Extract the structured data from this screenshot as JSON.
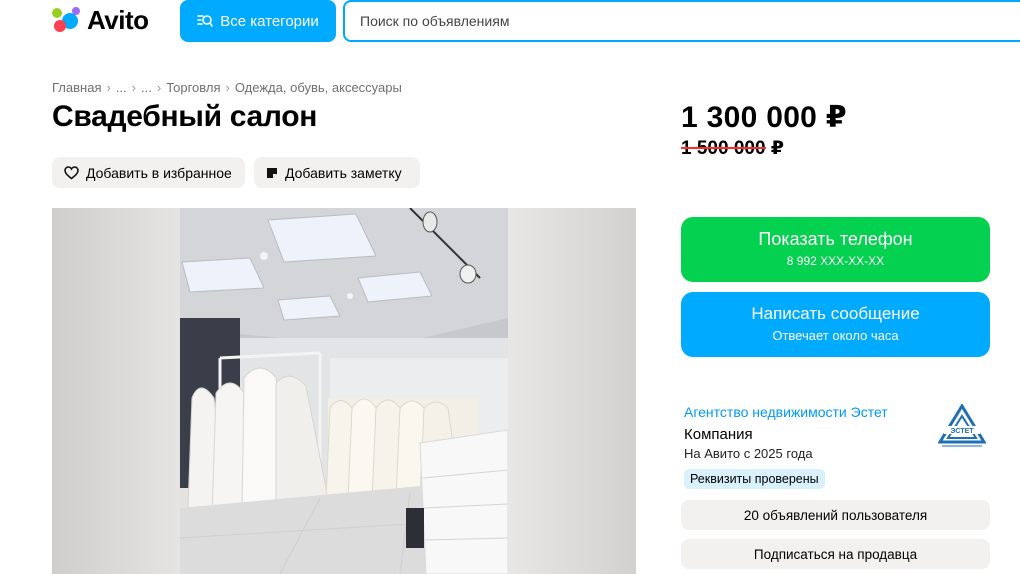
{
  "header": {
    "logo_text": "Avito",
    "categories_label": "Все категории",
    "search_placeholder": "Поиск по объявлениям"
  },
  "breadcrumb": {
    "items": [
      "Главная",
      "...",
      "...",
      "Торговля",
      "Одежда, обувь, аксессуары"
    ]
  },
  "listing": {
    "title": "Свадебный салон",
    "favorite_label": "Добавить в избранное",
    "note_label": "Добавить заметку",
    "price": "1 300 000 ₽",
    "old_price": "1 500 000 ₽"
  },
  "contact": {
    "show_phone_label": "Показать телефон",
    "phone_masked": "8 992 XXX-XX-XX",
    "write_message_label": "Написать сообщение",
    "response_time": "Отвечает около часа"
  },
  "seller": {
    "name": "Агентство недвижимости Эстет",
    "type": "Компания",
    "since": "На Авито с 2025 года",
    "verified_badge": "Реквизиты проверены",
    "logo_text": "ЭСТЕТ",
    "ads_count_label": "20 объявлений пользователя",
    "subscribe_label": "Подписаться на продавца"
  },
  "colors": {
    "brand_blue": "#00aaff",
    "green": "#03d14f",
    "link_blue": "#0099f7",
    "strike_red": "#ff2a2a",
    "pill_bg": "#f2f1ef"
  }
}
